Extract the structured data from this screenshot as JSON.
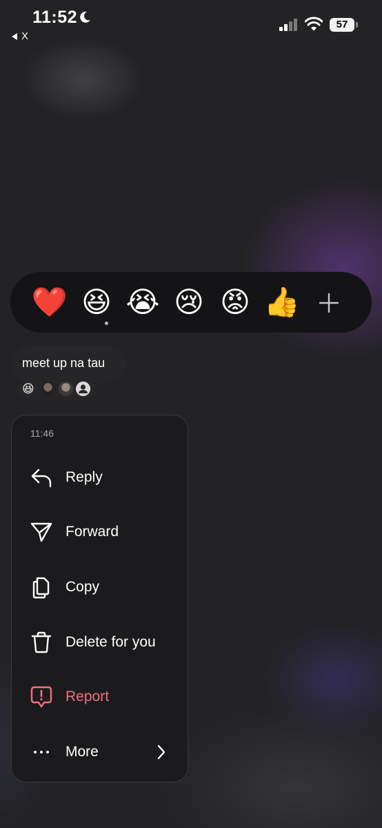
{
  "status_bar": {
    "time": "11:52",
    "back_app": "X",
    "battery": "57",
    "icons": [
      "moon-icon",
      "signal-icon",
      "wifi-icon",
      "battery-icon"
    ]
  },
  "reactions": {
    "items": [
      {
        "name": "red-heart",
        "emoji": "❤️"
      },
      {
        "name": "laughing",
        "emoji": "😆"
      },
      {
        "name": "loudly-crying",
        "emoji": "😭"
      },
      {
        "name": "crying",
        "emoji": "😢"
      },
      {
        "name": "angry",
        "emoji": "😡"
      },
      {
        "name": "thumbs-up",
        "emoji": "👍"
      }
    ],
    "selected": "laughing",
    "more_icon": "plus-icon"
  },
  "message": {
    "text": "meet up na tau",
    "reaction_emoji": "😆",
    "reactor_avatar_count": 3
  },
  "context_menu": {
    "timestamp": "11:46",
    "items": [
      {
        "label": "Reply",
        "icon": "reply-icon"
      },
      {
        "label": "Forward",
        "icon": "forward-icon"
      },
      {
        "label": "Copy",
        "icon": "copy-icon"
      },
      {
        "label": "Delete for you",
        "icon": "trash-icon"
      },
      {
        "label": "Report",
        "icon": "report-icon",
        "color": "#f4727e"
      },
      {
        "label": "More",
        "icon": "more-dots-icon",
        "trailing_icon": "chevron-right-icon"
      }
    ]
  },
  "colors": {
    "background": "#232325",
    "reaction_bar": "#141416",
    "bubble": "#262628",
    "menu": "#1b1b1d",
    "danger": "#f4727e"
  }
}
